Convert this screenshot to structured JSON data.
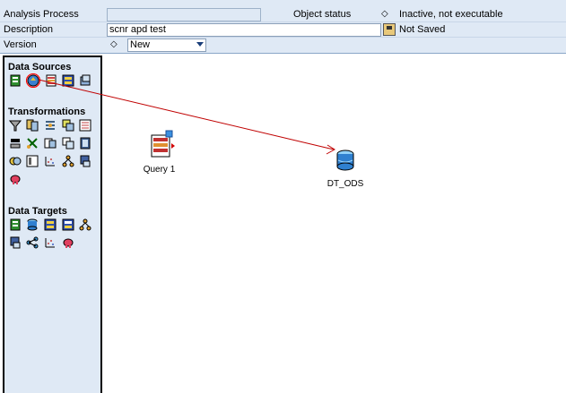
{
  "header": {
    "analysis_process_label": "Analysis Process",
    "analysis_process_value": "",
    "object_status_label": "Object status",
    "object_status_value": "Inactive, not executable",
    "description_label": "Description",
    "description_value": "scnr apd test",
    "save_status": "Not Saved",
    "version_label": "Version",
    "version_value": "New"
  },
  "palette": {
    "sections": [
      {
        "title": "Data Sources"
      },
      {
        "title": "Transformations"
      },
      {
        "title": "Data Targets"
      }
    ]
  },
  "canvas": {
    "nodes": [
      {
        "label": "Query 1",
        "icon": "query-icon"
      },
      {
        "label": "DT_ODS",
        "icon": "ods-database-icon"
      }
    ],
    "connection_color": "#c00000"
  },
  "colors": {
    "panel_bg": "#dfe9f5",
    "arrow": "#c00000",
    "highlight_circle": "#ff0000"
  }
}
